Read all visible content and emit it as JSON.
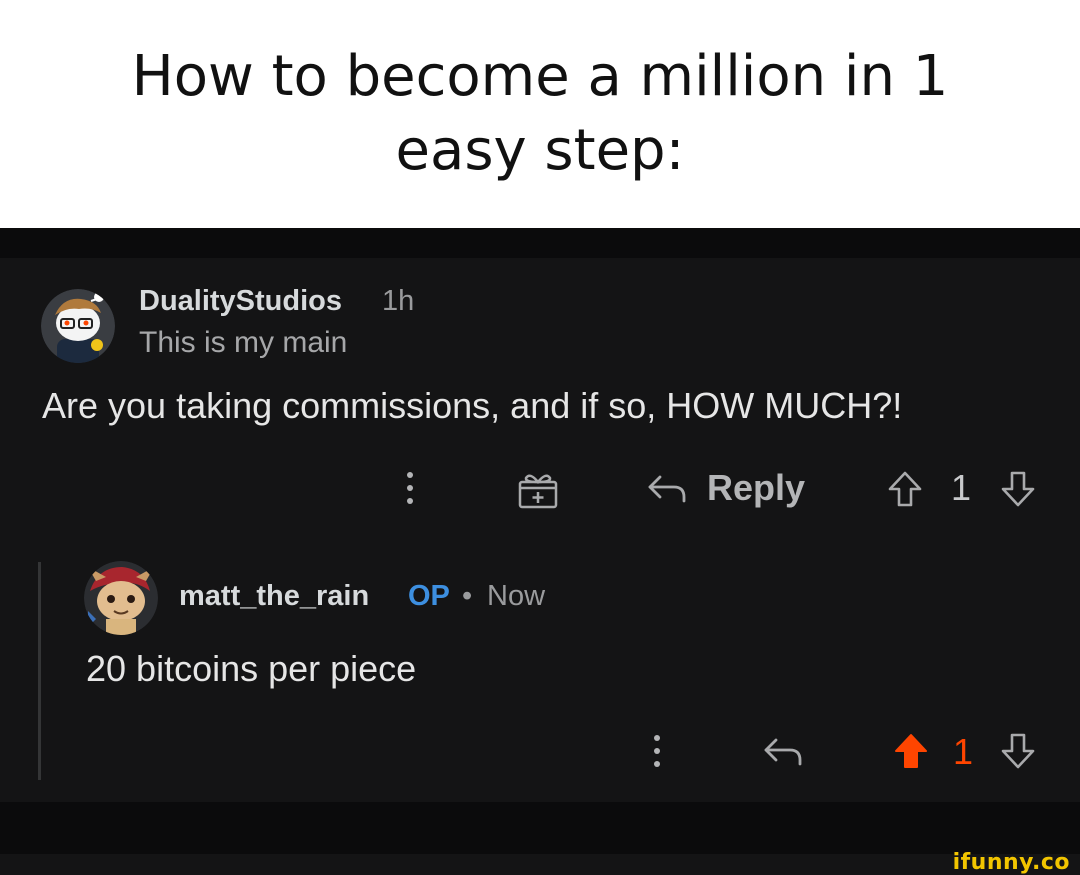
{
  "caption": {
    "text": "How to become a million in 1 easy step:"
  },
  "comment1": {
    "username": "DualityStudios",
    "time": "1h",
    "flair": "This is my main",
    "body": "Are you taking commissions, and if so, HOW MUCH?!",
    "actions": {
      "more_icon": "kebab-icon",
      "award_icon": "gift-icon",
      "reply_icon": "reply-arrow-icon",
      "reply_label": "Reply",
      "upvote_icon": "upvote-arrow-icon",
      "vote_count": "1",
      "downvote_icon": "downvote-arrow-icon"
    }
  },
  "comment2": {
    "username": "matt_the_rain",
    "op_badge": "OP",
    "separator": "•",
    "time": "Now",
    "body": "20 bitcoins per piece",
    "actions": {
      "more_icon": "kebab-icon",
      "reply_icon": "reply-arrow-icon",
      "upvote_icon": "upvote-filled-icon",
      "vote_count": "1",
      "downvote_icon": "downvote-arrow-icon"
    }
  },
  "colors": {
    "background": "#141415",
    "upvote_active": "#ff4500",
    "op_badge": "#3d8fe0",
    "watermark": "#f2c500"
  },
  "watermark": {
    "text": "ifunny.co"
  }
}
